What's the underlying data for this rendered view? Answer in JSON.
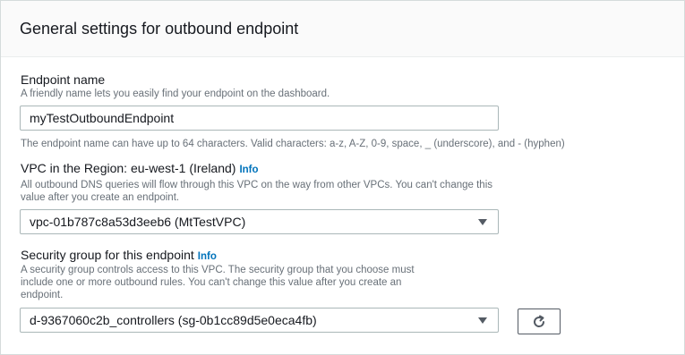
{
  "panel": {
    "title": "General settings for outbound endpoint"
  },
  "endpoint_name": {
    "label": "Endpoint name",
    "description": "A friendly name lets you easily find your endpoint on the dashboard.",
    "value": "myTestOutboundEndpoint",
    "constraint": "The endpoint name can have up to 64 characters. Valid characters: a-z, A-Z, 0-9, space, _ (underscore), and - (hyphen)"
  },
  "vpc": {
    "label": "VPC in the Region: eu-west-1 (Ireland)",
    "info": "Info",
    "description": "All outbound DNS queries will flow through this VPC on the way from other VPCs. You can't change this value after you create an endpoint.",
    "selected": "vpc-01b787c8a53d3eeb6 (MtTestVPC)"
  },
  "security_group": {
    "label": "Security group for this endpoint",
    "info": "Info",
    "description": "A security group controls access to this VPC. The security group that you choose must include one or more outbound rules. You can't change this value after you create an endpoint.",
    "selected": "d-9367060c2b_controllers (sg-0b1cc89d5e0eca4fb)",
    "refresh_icon": "refresh-icon"
  },
  "colors": {
    "accent": "#0073bb",
    "text": "#16191f",
    "muted": "#687078",
    "border": "#aab7b8"
  }
}
